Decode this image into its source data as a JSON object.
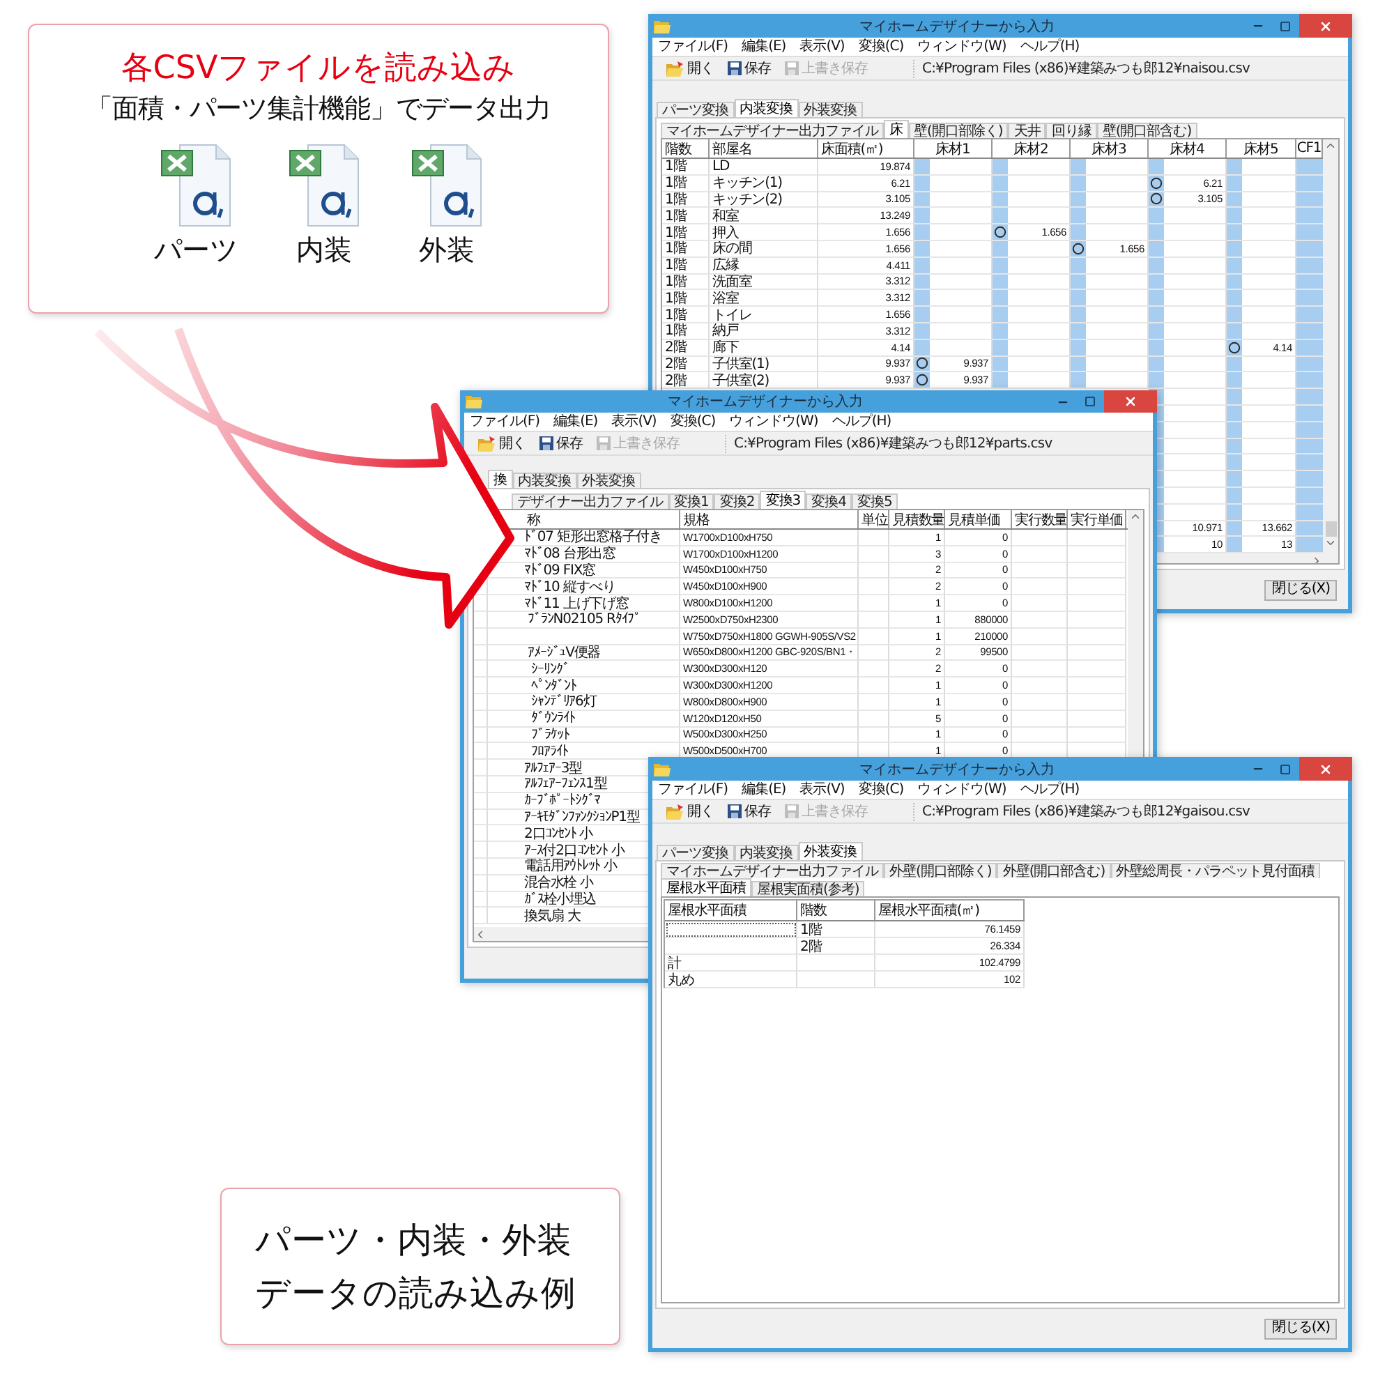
{
  "callout_top": {
    "title": "各CSVファイルを読み込み",
    "subtitle": "「面積・パーツ集計機能」でデータ出力",
    "files": [
      {
        "label": "パーツ"
      },
      {
        "label": "内装"
      },
      {
        "label": "外装"
      }
    ]
  },
  "windows": [
    {
      "title": "マイホームデザイナーから入力",
      "menu": [
        "ファイル(F)",
        "編集(E)",
        "表示(V)",
        "変換(C)",
        "ウィンドウ(W)",
        "ヘルプ(H)"
      ],
      "toolbar": [
        {
          "kind": "open",
          "label": "開く",
          "disabled": false
        },
        {
          "kind": "save",
          "label": "保存",
          "disabled": false
        },
        {
          "kind": "save",
          "label": "上書き保存",
          "disabled": true
        }
      ],
      "path": "C:¥Program Files (x86)¥建築みつも郎12¥naisou.csv",
      "tabs": [
        {
          "label": "パーツ変換",
          "selected": false
        },
        {
          "label": "内装変換",
          "selected": true
        },
        {
          "label": "外装変換",
          "selected": false
        }
      ],
      "subtabs": [
        {
          "label": "マイホームデザイナー出力ファイル",
          "selected": false
        },
        {
          "label": "床",
          "selected": true
        },
        {
          "label": "壁(開口部除く)",
          "selected": false
        },
        {
          "label": "天井",
          "selected": false
        },
        {
          "label": "回り縁",
          "selected": false
        },
        {
          "label": "壁(開口部含む)",
          "selected": false
        }
      ],
      "grid": {
        "kind": "floor",
        "columns": [
          "階数",
          "部屋名",
          "床面積(㎡)",
          "床材1",
          "床材2",
          "床材3",
          "床材4",
          "床材5",
          "CF1"
        ],
        "rows": [
          {
            "floor": "1階",
            "room": "LD",
            "area": "19.874",
            "materials": [
              {
                "checked": false
              },
              {
                "checked": false
              },
              {
                "checked": false
              },
              {
                "checked": false
              },
              {
                "checked": false
              }
            ]
          },
          {
            "floor": "1階",
            "room": "キッチン(1)",
            "area": "6.21",
            "materials": [
              {
                "checked": false
              },
              {
                "checked": false
              },
              {
                "checked": false
              },
              {
                "checked": true,
                "value": "6.21"
              },
              {
                "checked": false
              }
            ]
          },
          {
            "floor": "1階",
            "room": "キッチン(2)",
            "area": "3.105",
            "materials": [
              {
                "checked": false
              },
              {
                "checked": false
              },
              {
                "checked": false
              },
              {
                "checked": true,
                "value": "3.105"
              },
              {
                "checked": false
              }
            ]
          },
          {
            "floor": "1階",
            "room": "和室",
            "area": "13.249",
            "materials": [
              {
                "checked": false
              },
              {
                "checked": false
              },
              {
                "checked": false
              },
              {
                "checked": false
              },
              {
                "checked": false
              }
            ]
          },
          {
            "floor": "1階",
            "room": "押入",
            "area": "1.656",
            "materials": [
              {
                "checked": false
              },
              {
                "checked": true,
                "value": "1.656"
              },
              {
                "checked": false
              },
              {
                "checked": false
              },
              {
                "checked": false
              }
            ]
          },
          {
            "floor": "1階",
            "room": "床の間",
            "area": "1.656",
            "materials": [
              {
                "checked": false
              },
              {
                "checked": false
              },
              {
                "checked": true,
                "value": "1.656"
              },
              {
                "checked": false
              },
              {
                "checked": false
              }
            ]
          },
          {
            "floor": "1階",
            "room": "広縁",
            "area": "4.411",
            "materials": [
              {
                "checked": false
              },
              {
                "checked": false
              },
              {
                "checked": false
              },
              {
                "checked": false
              },
              {
                "checked": false
              }
            ]
          },
          {
            "floor": "1階",
            "room": "洗面室",
            "area": "3.312",
            "materials": [
              {
                "checked": false
              },
              {
                "checked": false
              },
              {
                "checked": false
              },
              {
                "checked": false
              },
              {
                "checked": false
              }
            ]
          },
          {
            "floor": "1階",
            "room": "浴室",
            "area": "3.312",
            "materials": [
              {
                "checked": false
              },
              {
                "checked": false
              },
              {
                "checked": false
              },
              {
                "checked": false
              },
              {
                "checked": false
              }
            ]
          },
          {
            "floor": "1階",
            "room": "トイレ",
            "area": "1.656",
            "materials": [
              {
                "checked": false
              },
              {
                "checked": false
              },
              {
                "checked": false
              },
              {
                "checked": false
              },
              {
                "checked": false
              }
            ]
          },
          {
            "floor": "1階",
            "room": "納戸",
            "area": "3.312",
            "materials": [
              {
                "checked": false
              },
              {
                "checked": false
              },
              {
                "checked": false
              },
              {
                "checked": false
              },
              {
                "checked": false
              }
            ]
          },
          {
            "floor": "2階",
            "room": "廊下",
            "area": "4.14",
            "materials": [
              {
                "checked": false
              },
              {
                "checked": false
              },
              {
                "checked": false
              },
              {
                "checked": false
              },
              {
                "checked": true,
                "value": "4.14"
              }
            ]
          },
          {
            "floor": "2階",
            "room": "子供室(1)",
            "area": "9.937",
            "materials": [
              {
                "checked": true,
                "value": "9.937"
              },
              {
                "checked": false
              },
              {
                "checked": false
              },
              {
                "checked": false
              },
              {
                "checked": false
              }
            ]
          },
          {
            "floor": "2階",
            "room": "子供室(2)",
            "area": "9.937",
            "materials": [
              {
                "checked": true,
                "value": "9.937"
              },
              {
                "checked": false
              },
              {
                "checked": false
              },
              {
                "checked": false
              },
              {
                "checked": false
              }
            ]
          }
        ],
        "tail_rows": [
          {
            "values": [
              "10.971",
              "13.662"
            ]
          },
          {
            "values": [
              "10",
              "13"
            ]
          }
        ]
      },
      "close_button": "閉じる(X)"
    },
    {
      "title": "マイホームデザイナーから入力",
      "menu": [
        "ファイル(F)",
        "編集(E)",
        "表示(V)",
        "変換(C)",
        "ウィンドウ(W)",
        "ヘルプ(H)"
      ],
      "toolbar": [
        {
          "kind": "open",
          "label": "開く",
          "disabled": false
        },
        {
          "kind": "save",
          "label": "保存",
          "disabled": false
        },
        {
          "kind": "save",
          "label": "上書き保存",
          "disabled": true
        }
      ],
      "path": "C:¥Program Files (x86)¥建築みつも郎12¥parts.csv",
      "tabs": [
        {
          "label": "換",
          "selected": true
        },
        {
          "label": "内装変換",
          "selected": false
        },
        {
          "label": "外装変換",
          "selected": false
        }
      ],
      "subtabs": [
        {
          "label": "デザイナー出力ファイル",
          "selected": false
        },
        {
          "label": "変換1",
          "selected": false
        },
        {
          "label": "変換2",
          "selected": false
        },
        {
          "label": "変換3",
          "selected": true
        },
        {
          "label": "変換4",
          "selected": false
        },
        {
          "label": "変換5",
          "selected": false
        }
      ],
      "grid": {
        "kind": "parts",
        "columns": [
          "称",
          "規格",
          "単位",
          "見積数量",
          "見積単価",
          "実行数量",
          "実行単価"
        ],
        "rows": [
          {
            "name": "ﾄﾞ07 矩形出窓格子付き",
            "spec": "W1700xD100xH750",
            "qty": "1",
            "price": "0"
          },
          {
            "name": "ﾏﾄﾞ08 台形出窓",
            "spec": "W1700xD100xH1200",
            "qty": "3",
            "price": "0"
          },
          {
            "name": "ﾏﾄﾞ09 FIX窓",
            "spec": "W450xD100xH750",
            "qty": "2",
            "price": "0"
          },
          {
            "name": "ﾏﾄﾞ10 縦すべり",
            "spec": "W450xD100xH900",
            "qty": "2",
            "price": "0"
          },
          {
            "name": "ﾏﾄﾞ11 上げ下げ窓",
            "spec": "W800xD100xH1200",
            "qty": "1",
            "price": "0"
          },
          {
            "name": " ﾌﾞﾗﾝN02105 Rﾀｲﾌﾟ",
            "spec": "W2500xD750xH2300",
            "qty": "1",
            "price": "880000"
          },
          {
            "spec": "W750xD750xH1800 GGWH-905S/VS2",
            "qty": "1",
            "price": "210000"
          },
          {
            "name": " ｱﾒｰｼﾞｭV便器",
            "spec": "W650xD800xH1200 GBC-920S/BN1・",
            "qty": "2",
            "price": "99500"
          },
          {
            "name": "  ｼｰﾘﾝｸﾞ",
            "spec": "W300xD300xH120",
            "qty": "2",
            "price": "0"
          },
          {
            "name": "  ﾍﾟﾝﾀﾞﾝﾄ",
            "spec": "W300xD300xH1200",
            "qty": "1",
            "price": "0"
          },
          {
            "name": "  ｼｬﾝﾃﾞﾘｱ6灯",
            "spec": "W800xD800xH900",
            "qty": "1",
            "price": "0"
          },
          {
            "name": "  ﾀﾞｳﾝﾗｲﾄ",
            "spec": "W120xD120xH50",
            "qty": "5",
            "price": "0"
          },
          {
            "name": "  ﾌﾞﾗｹｯﾄ",
            "spec": "W500xD300xH250",
            "qty": "1",
            "price": "0"
          },
          {
            "name": "  ﾌﾛｱﾗｲﾄ",
            "spec": "W500xD500xH700",
            "qty": "1",
            "price": "0"
          },
          {
            "name": "ｱﾙﾌｪｱｰ3型"
          },
          {
            "name": "ｱﾙﾌｪｱｰﾌｪﾝｽ1型"
          },
          {
            "name": "ｶｰﾌﾞﾎﾟｰﾄｼｸﾞﾏ"
          },
          {
            "name": "ｱｰｷﾓﾀﾞﾝﾌｧﾝｸｼｮﾝP1型"
          },
          {
            "name": "2口ｺﾝｾﾝﾄ 小"
          },
          {
            "name": "ｱｰｽ付2口ｺﾝｾﾝﾄ 小"
          },
          {
            "name": "電話用ｱｳﾄﾚｯﾄ 小"
          },
          {
            "name": "混合水栓 小"
          },
          {
            "name": "ｶﾞｽ栓小埋込"
          },
          {
            "name": "換気扇 大"
          }
        ]
      }
    },
    {
      "title": "マイホームデザイナーから入力",
      "menu": [
        "ファイル(F)",
        "編集(E)",
        "表示(V)",
        "変換(C)",
        "ウィンドウ(W)",
        "ヘルプ(H)"
      ],
      "toolbar": [
        {
          "kind": "open",
          "label": "開く",
          "disabled": false
        },
        {
          "kind": "save",
          "label": "保存",
          "disabled": false
        },
        {
          "kind": "save",
          "label": "上書き保存",
          "disabled": true
        }
      ],
      "path": "C:¥Program Files (x86)¥建築みつも郎12¥gaisou.csv",
      "tabs": [
        {
          "label": "パーツ変換",
          "selected": false
        },
        {
          "label": "内装変換",
          "selected": false
        },
        {
          "label": "外装変換",
          "selected": true
        }
      ],
      "subtabs": [
        {
          "label": "マイホームデザイナー出力ファイル",
          "selected": false
        },
        {
          "label": "外壁(開口部除く)",
          "selected": false
        },
        {
          "label": "外壁(開口部含む)",
          "selected": false
        },
        {
          "label": "外壁総周長・パラペット見付面積",
          "selected": false
        },
        {
          "label": "屋根水平面積",
          "selected": true
        },
        {
          "label": "屋根実面積(参考)",
          "selected": false
        }
      ],
      "grid": {
        "kind": "roof",
        "columns": [
          "屋根水平面積",
          "階数",
          "屋根水平面積(㎡)"
        ],
        "rows": [
          {
            "floor": "1階",
            "area": "76.1459",
            "focused": true
          },
          {
            "floor": "2階",
            "area": "26.334",
            "focused": false
          },
          {
            "label": "計",
            "area": "102.4799",
            "focused": false
          },
          {
            "label": "丸め",
            "area": "102",
            "focused": false
          }
        ]
      },
      "close_button": "閉じる(X)"
    }
  ],
  "callout_bottom": {
    "lines": [
      "パーツ・内装・外装",
      "データの読み込み例"
    ]
  }
}
